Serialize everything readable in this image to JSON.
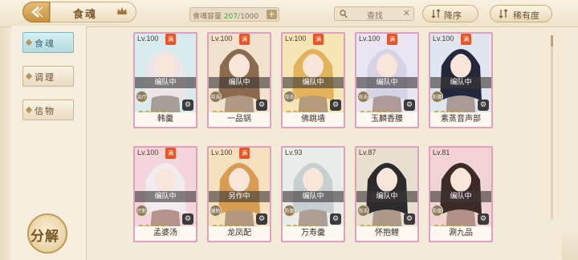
{
  "header": {
    "title": "食魂",
    "capacity_label": "食魂容量",
    "capacity_current": "207",
    "capacity_max": "/1000",
    "capacity_add": "+",
    "search_placeholder": "查找",
    "search_clear": "✕",
    "sort_label": "降序",
    "rarity_label": "稀有度"
  },
  "sidebar": {
    "tabs": [
      {
        "label": "食魂",
        "active": true
      },
      {
        "label": "调理",
        "active": false
      },
      {
        "label": "信物",
        "active": false
      }
    ],
    "decompose_label": "分解"
  },
  "cards": [
    {
      "level": "Lv.100",
      "max_badge": "满",
      "status": "编队中",
      "role": "治疗",
      "stars": 5,
      "name": "韩羹",
      "hair": "#ece6ea",
      "bg": "#d8ebef"
    },
    {
      "level": "Lv.100",
      "max_badge": "满",
      "status": "编队中",
      "role": "攻击",
      "stars": 5,
      "name": "一品锅",
      "hair": "#8b6a4e",
      "bg": "#f0e2cc"
    },
    {
      "level": "Lv.100",
      "max_badge": "满",
      "status": "编队中",
      "role": "攻击",
      "stars": 5,
      "name": "佛跳墙",
      "hair": "#e3b25a",
      "bg": "#f6e6b6"
    },
    {
      "level": "Lv.100",
      "max_badge": "满",
      "status": "编队中",
      "role": "攻击",
      "stars": 5,
      "name": "玉麟香腰",
      "hair": "#d7d3e6",
      "bg": "#eae5f3"
    },
    {
      "level": "Lv.100",
      "max_badge": "满",
      "status": "编队中",
      "role": "防御",
      "stars": 5,
      "name": "素蒸音声部",
      "hair": "#25283c",
      "bg": "#dfe6f0"
    },
    {
      "level": "Lv.100",
      "max_badge": "满",
      "status": "编队中",
      "role": "控制",
      "stars": 5,
      "name": "孟婆汤",
      "hair": "#f1ecef",
      "bg": "#f4d5dc"
    },
    {
      "level": "Lv.100",
      "max_badge": "满",
      "status": "另作中",
      "role": "辅助",
      "stars": 5,
      "name": "龙凤配",
      "hair": "#d89c52",
      "bg": "#f6e1bf"
    },
    {
      "level": "Lv.93",
      "max_badge": "",
      "status": "编队中",
      "role": "防御",
      "stars": 5,
      "name": "万寿羹",
      "hair": "#c8cfd0",
      "bg": "#e9eeea"
    },
    {
      "level": "Lv.87",
      "max_badge": "",
      "status": "编队中",
      "role": "攻击",
      "stars": 5,
      "name": "怀抱鲤",
      "hair": "#2d2a2d",
      "bg": "#e8dfd0"
    },
    {
      "level": "Lv.81",
      "max_badge": "",
      "status": "编队中",
      "role": "防御",
      "stars": 5,
      "name": "涮九品",
      "hair": "#3b2a26",
      "bg": "#f1d3d3"
    }
  ],
  "icons": [
    "back-arrow-icon",
    "crown-icon",
    "search-icon",
    "sort-icon",
    "rarity-icon",
    "gear-icon"
  ]
}
